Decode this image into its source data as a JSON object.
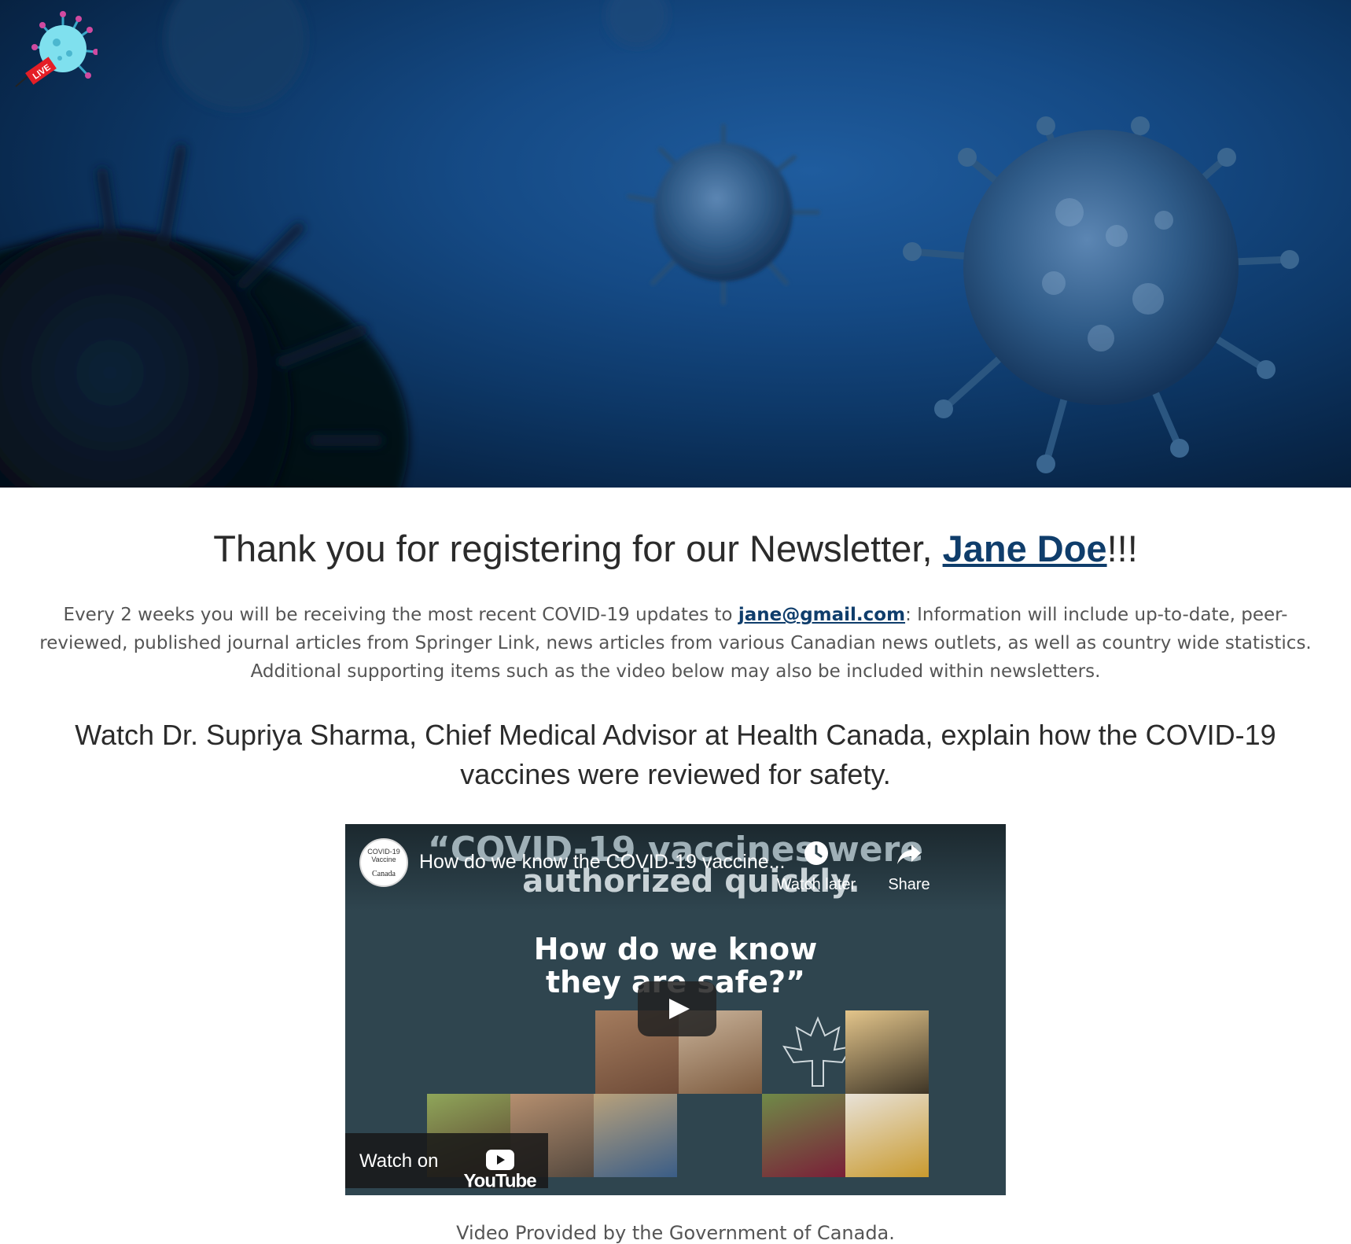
{
  "logo": {
    "icon": "coronavirus-live-icon",
    "badge_text": "LIVE"
  },
  "header": {
    "thanks_prefix": "Thank you for registering for our Newsletter, ",
    "user_name": "Jane Doe",
    "thanks_suffix": "!!!"
  },
  "description": {
    "prefix": "Every 2 weeks you will be receiving the most recent COVID-19 updates to ",
    "email": "jane@gmail.com",
    "suffix": ": Information will include up-to-date, peer-reviewed, published journal articles from Springer Link, news articles from various Canadian news outlets, as well as country wide statistics. Additional supporting items such as the video below may also be included within newsletters."
  },
  "watch_heading": "Watch Dr. Supriya Sharma, Chief Medical Advisor at Health Canada, explain how the COVID-19 vaccines were reviewed for safety.",
  "video": {
    "title": "How do we know the COVID-19 vaccine...",
    "quote_line1": "“COVID-19 vaccines were",
    "quote_line2": "authorized quickly.",
    "quote_line3": "How do we know",
    "quote_line4": "they are safe?”",
    "channel_top": "COVID-19 Vaccine",
    "channel_bottom": "Canada",
    "watch_later_label": "Watch later",
    "share_label": "Share",
    "watch_on_label": "Watch on",
    "youtube_label": "YouTube"
  },
  "caption": "Video Provided by the Government of Canada.",
  "colors": {
    "link": "#0f3d6b",
    "video_bg": "#2f454f",
    "hero_blue": "#154a85"
  }
}
